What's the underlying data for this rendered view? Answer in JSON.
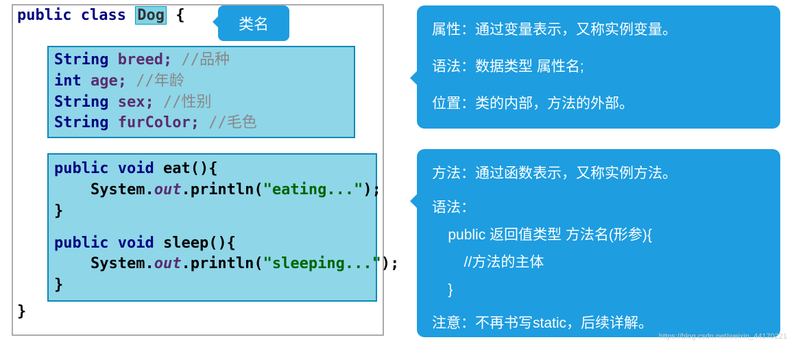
{
  "code": {
    "decl_kw1": "public",
    "decl_kw2": "class",
    "class_name": "Dog",
    "open_brace": "{",
    "close_brace": "}",
    "attrs": {
      "l1_type": "String",
      "l1_name": "breed;",
      "l1_comment": "//品种",
      "l2_type": "int",
      "l2_name": "age;",
      "l2_comment": "//年龄",
      "l3_type": "String",
      "l3_name": "sex;",
      "l3_comment": "//性别",
      "l4_type": "String",
      "l4_name": "furColor;",
      "l4_comment": "//毛色"
    },
    "methods": {
      "m1_sig1": "public",
      "m1_sig2": "void",
      "m1_name": "eat(){",
      "m1_body_pre": "    System.",
      "m1_out": "out",
      "m1_body_post": ".println(",
      "m1_str": "\"eating...\"",
      "m1_end": ");",
      "m1_close": "}",
      "m2_sig1": "public",
      "m2_sig2": "void",
      "m2_name": "sleep(){",
      "m2_body_pre": "    System.",
      "m2_out": "out",
      "m2_body_post": ".println(",
      "m2_str": "\"sleeping...\"",
      "m2_end": ");",
      "m2_close": "}"
    }
  },
  "labels": {
    "classname": "类名"
  },
  "callout1": {
    "l1": "属性：通过变量表示，又称实例变量。",
    "l2": "语法：数据类型 属性名;",
    "l3": "位置：类的内部，方法的外部。"
  },
  "callout2": {
    "l1": "方法：通过函数表示，又称实例方法。",
    "l2": "语法：",
    "l3": "    public 返回值类型 方法名(形参){",
    "l4": "        //方法的主体",
    "l5": "    }",
    "l6": "注意：不再书写static，后续详解。"
  },
  "watermark": "https://blog.csdn.net/weixin_44170221"
}
